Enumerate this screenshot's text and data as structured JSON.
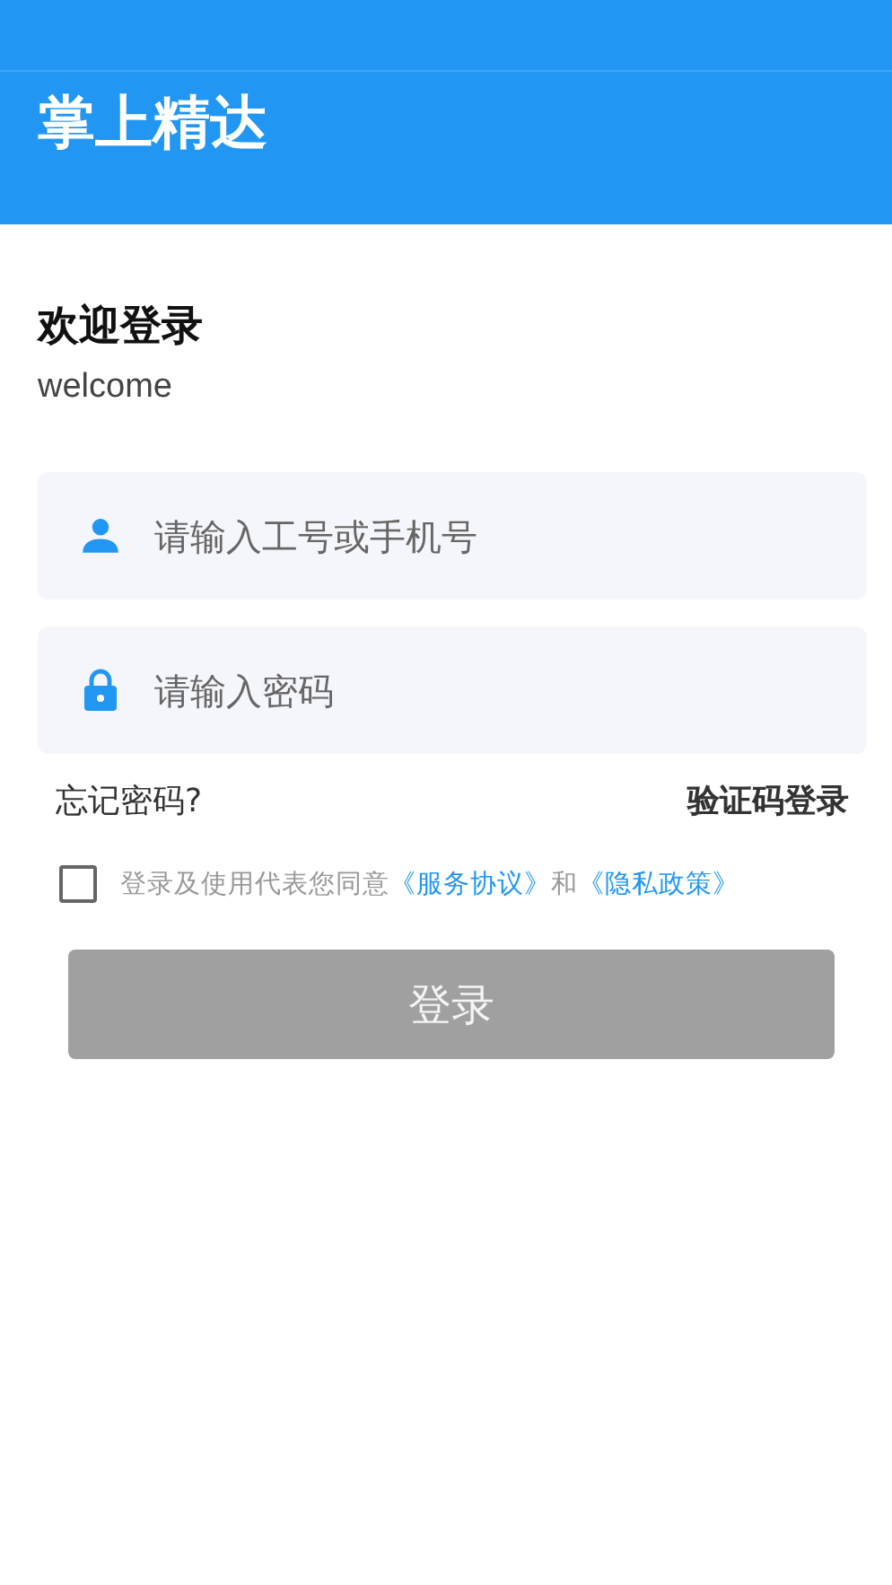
{
  "header": {
    "title": "掌上精达"
  },
  "greeting": {
    "title": "欢迎登录",
    "subtitle": "welcome"
  },
  "fields": [
    {
      "kind": "user",
      "placeholder": "请输入工号或手机号"
    },
    {
      "kind": "password",
      "placeholder": "请输入密码"
    }
  ],
  "links": {
    "forgot": "忘记密码?",
    "sms_login": "验证码登录"
  },
  "agreement": {
    "checked": false,
    "text": "登录及使用代表您同意",
    "link_1": "《服务协议》",
    "joiner": "和",
    "link_2": "《隐私政策》"
  },
  "login_button": {
    "label": "登录",
    "disabled": true
  }
}
